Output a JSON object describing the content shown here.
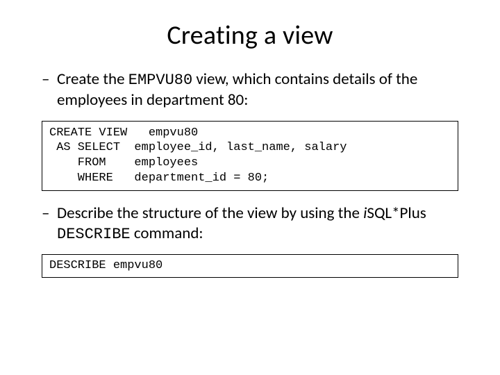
{
  "title": "Creating a view",
  "bullet1": {
    "dash": "–",
    "t1": "Create the ",
    "code": "EMPVU80",
    "t2": " view, which contains details of the employees in department 80:"
  },
  "code1": "CREATE VIEW   empvu80\n AS SELECT  employee_id, last_name, salary\n    FROM    employees\n    WHERE   department_id = 80;",
  "bullet2": {
    "dash": "–",
    "t1": "Describe the structure of the view by using the ",
    "ital": "i",
    "t2": "SQL*Plus ",
    "code": "DESCRIBE",
    "t3": " command:"
  },
  "code2": "DESCRIBE empvu80"
}
